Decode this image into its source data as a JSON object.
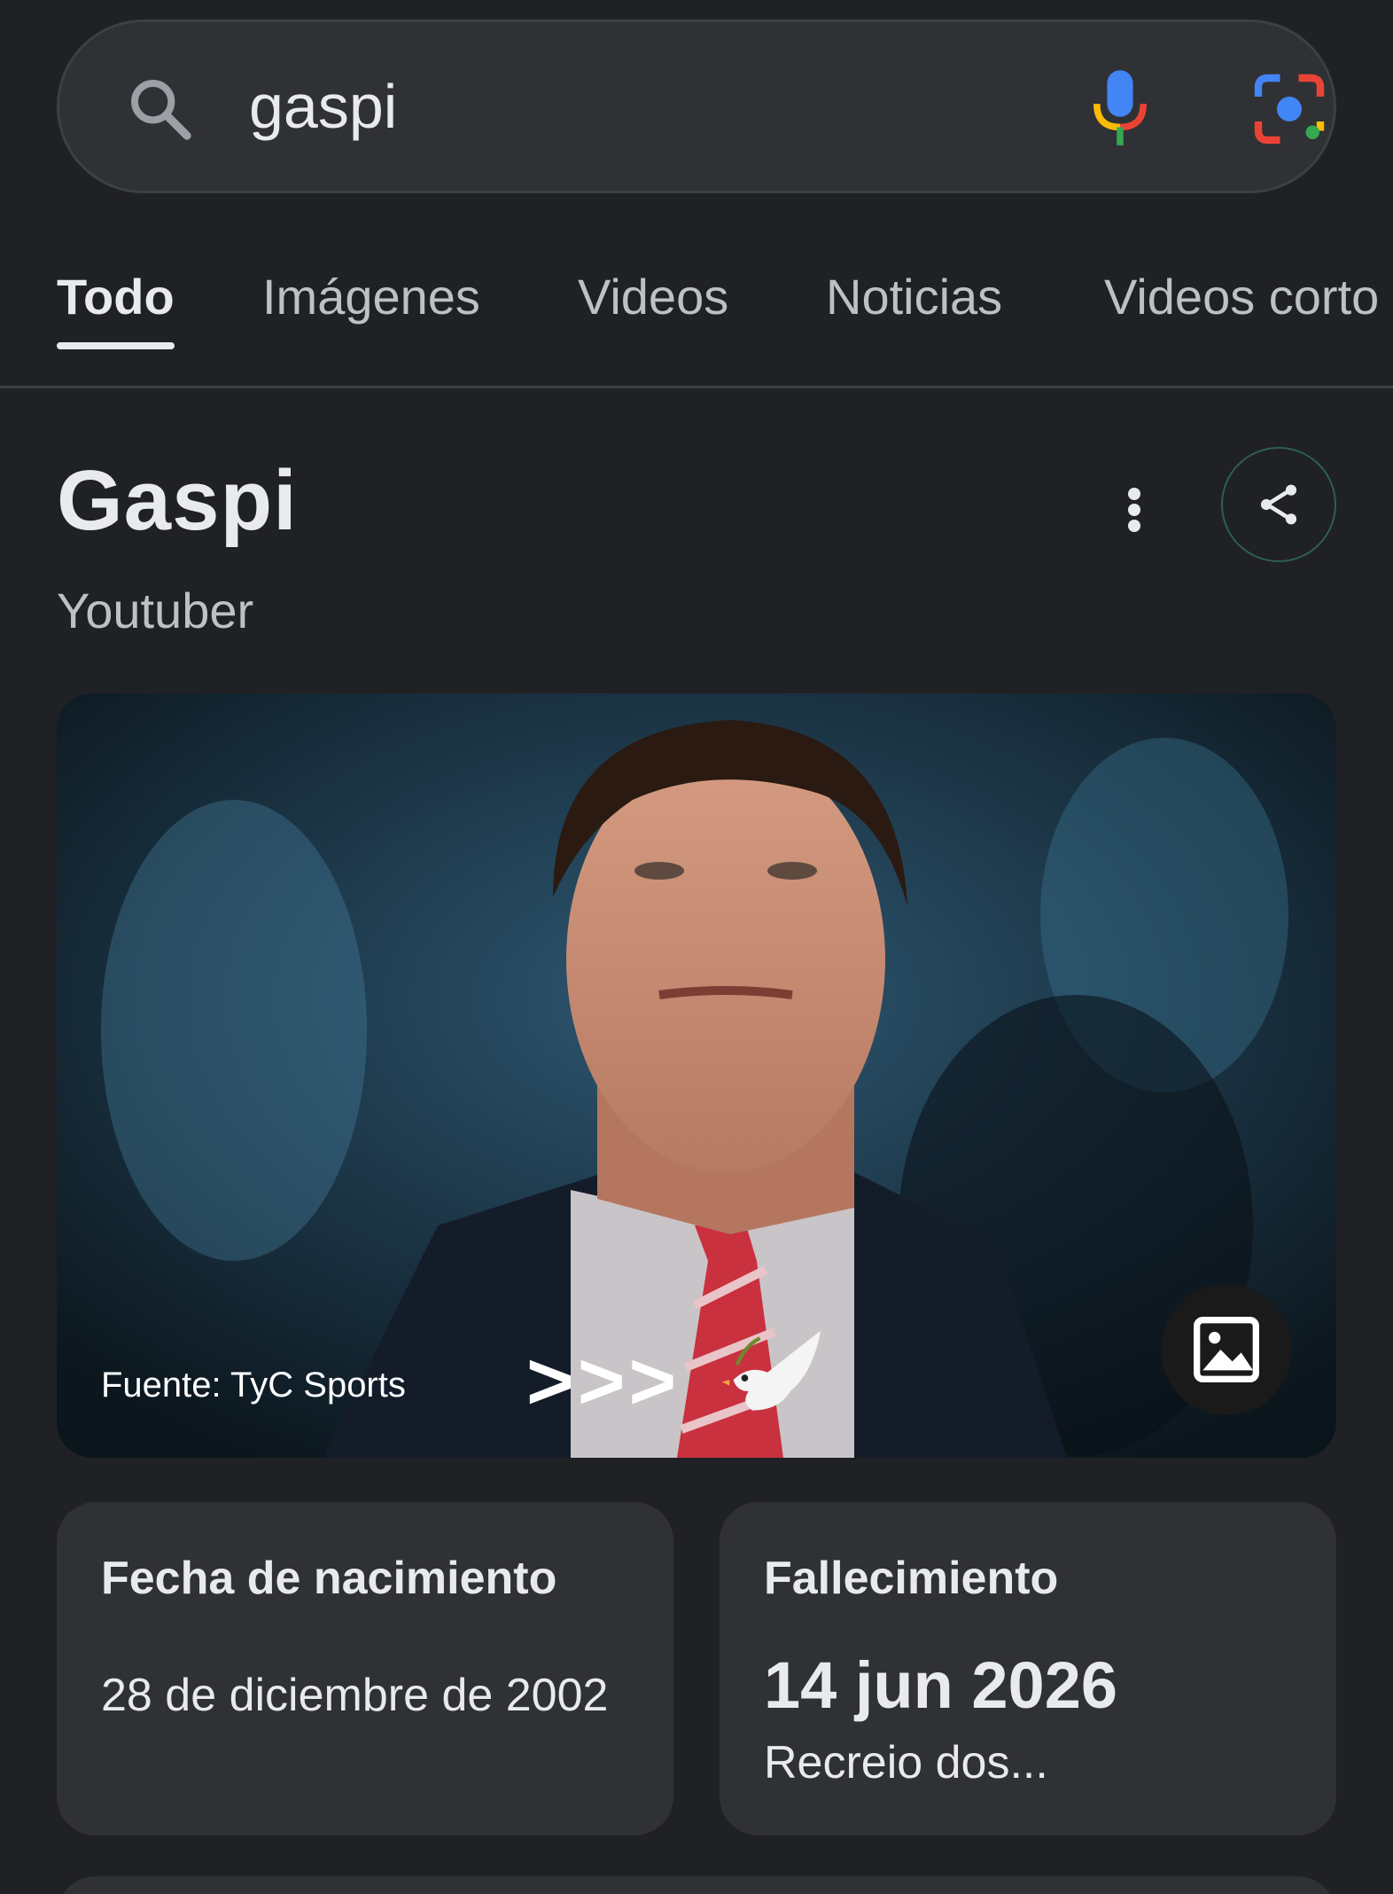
{
  "search": {
    "query": "gaspi",
    "icons": [
      "search-icon",
      "mic-icon",
      "lens-icon"
    ]
  },
  "tabs": [
    {
      "label": "Todo",
      "active": true
    },
    {
      "label": "Imágenes",
      "active": false
    },
    {
      "label": "Videos",
      "active": false
    },
    {
      "label": "Noticias",
      "active": false
    },
    {
      "label": "Videos corto",
      "active": false
    }
  ],
  "entity": {
    "title": "Gaspi",
    "subtitle": "Youtuber"
  },
  "hero": {
    "source": "Fuente: TyC Sports",
    "overlay_text": ">>>"
  },
  "facts": [
    {
      "label": "Fecha de nacimiento",
      "value": "28 de diciembre de 2002"
    },
    {
      "label": "Fallecimiento",
      "value": "14 jun 2026",
      "sub": "Recreio dos..."
    }
  ],
  "colors": {
    "background": "#202124",
    "surface": "#303134",
    "text": "#e8eaed",
    "muted": "#bdc1c6",
    "google_blue": "#4285f4",
    "google_red": "#ea4335",
    "google_yellow": "#fbbc04",
    "google_green": "#34a853"
  }
}
